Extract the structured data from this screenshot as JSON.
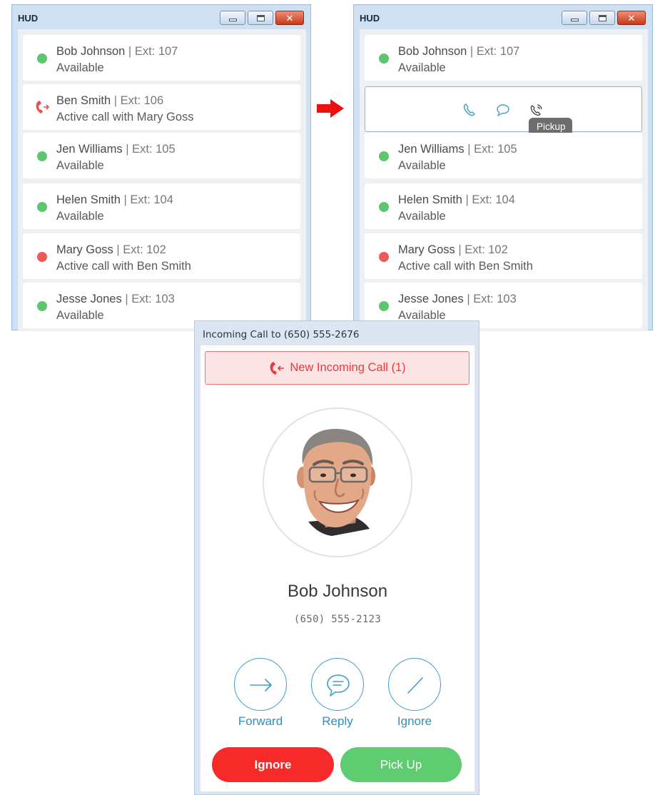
{
  "hud_left": {
    "title": "HUD",
    "contacts": [
      {
        "name": "Bob Johnson",
        "sep": "|",
        "ext": "Ext: 107",
        "status": "Available",
        "state": "available"
      },
      {
        "name": "Ben Smith",
        "sep": "|",
        "ext": "Ext: 106",
        "status": "Active call with Mary Goss",
        "state": "active-call-outgoing"
      },
      {
        "name": "Jen Williams",
        "sep": "|",
        "ext": "Ext: 105",
        "status": "Available",
        "state": "available"
      },
      {
        "name": "Helen Smith",
        "sep": "|",
        "ext": "Ext: 104",
        "status": "Available",
        "state": "available"
      },
      {
        "name": "Mary Goss",
        "sep": "|",
        "ext": "Ext: 102",
        "status": "Active call with Ben Smith",
        "state": "busy"
      },
      {
        "name": "Jesse Jones",
        "sep": "|",
        "ext": "Ext: 103",
        "status": "Available",
        "state": "available"
      }
    ]
  },
  "hud_right": {
    "title": "HUD",
    "contacts": [
      {
        "name": "Bob Johnson",
        "sep": "|",
        "ext": "Ext: 107",
        "status": "Available",
        "state": "available"
      },
      {
        "state": "selected-actions",
        "actions": [
          "phone-icon",
          "chat-bubble-icon",
          "pickup-phone-icon"
        ],
        "tooltip": "Pickup"
      },
      {
        "name": "Jen Williams",
        "sep": "|",
        "ext": "Ext: 105",
        "status": "Available",
        "state": "available"
      },
      {
        "name": "Helen Smith",
        "sep": "|",
        "ext": "Ext: 104",
        "status": "Available",
        "state": "available"
      },
      {
        "name": "Mary Goss",
        "sep": "|",
        "ext": "Ext: 102",
        "status": "Active call with Ben Smith",
        "state": "busy"
      },
      {
        "name": "Jesse Jones",
        "sep": "|",
        "ext": "Ext: 103",
        "status": "Available",
        "state": "available"
      }
    ]
  },
  "incoming": {
    "title": "Incoming Call to (650) 555-2676",
    "banner": "New Incoming Call (1)",
    "caller_name": "Bob Johnson",
    "caller_number": "(650) 555-2123",
    "actions": {
      "forward": "Forward",
      "reply": "Reply",
      "ignore": "Ignore"
    },
    "ignore_button": "Ignore",
    "pickup_button": "Pick Up"
  },
  "colors": {
    "available": "#5ec76e",
    "busy": "#ec5a5a",
    "accent_blue": "#3f9dc8",
    "ignore_red": "#f72a2a",
    "pickup_green": "#5fcc72"
  }
}
